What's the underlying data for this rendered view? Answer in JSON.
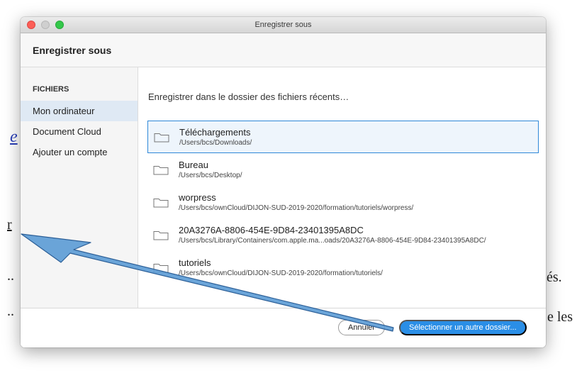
{
  "window": {
    "title": "Enregistrer sous"
  },
  "dialog": {
    "heading": "Enregistrer sous"
  },
  "sidebar": {
    "section": "FICHIERS",
    "items": [
      {
        "label": "Mon ordinateur",
        "active": true
      },
      {
        "label": "Document Cloud",
        "active": false
      },
      {
        "label": "Ajouter un compte",
        "active": false
      }
    ]
  },
  "main": {
    "heading": "Enregistrer dans le dossier des fichiers récents…",
    "folders": [
      {
        "name": "Téléchargements",
        "path": "/Users/bcs/Downloads/"
      },
      {
        "name": "Bureau",
        "path": "/Users/bcs/Desktop/"
      },
      {
        "name": "worpress",
        "path": "/Users/bcs/ownCloud/DIJON-SUD-2019-2020/formation/tutoriels/worpress/"
      },
      {
        "name": "20A3276A-8806-454E-9D84-23401395A8DC",
        "path": "/Users/bcs/Library/Containers/com.apple.ma...oads/20A3276A-8806-454E-9D84-23401395A8DC/"
      },
      {
        "name": "tutoriels",
        "path": "/Users/bcs/ownCloud/DIJON-SUD-2019-2020/formation/tutoriels/"
      }
    ]
  },
  "footer": {
    "cancel_label": "Annuler",
    "primary_label": "Sélectionner un autre dossier..."
  },
  "background": {
    "frag_link": "e",
    "frag_under": "r",
    "frag_es": "és.",
    "frag_les": "e les",
    "frag_dots1": "..",
    "frag_dots2": ".."
  },
  "colors": {
    "accent": "#2a8ee6",
    "selection_border": "#2f88d8",
    "arrow_fill": "#5b9bd5"
  }
}
